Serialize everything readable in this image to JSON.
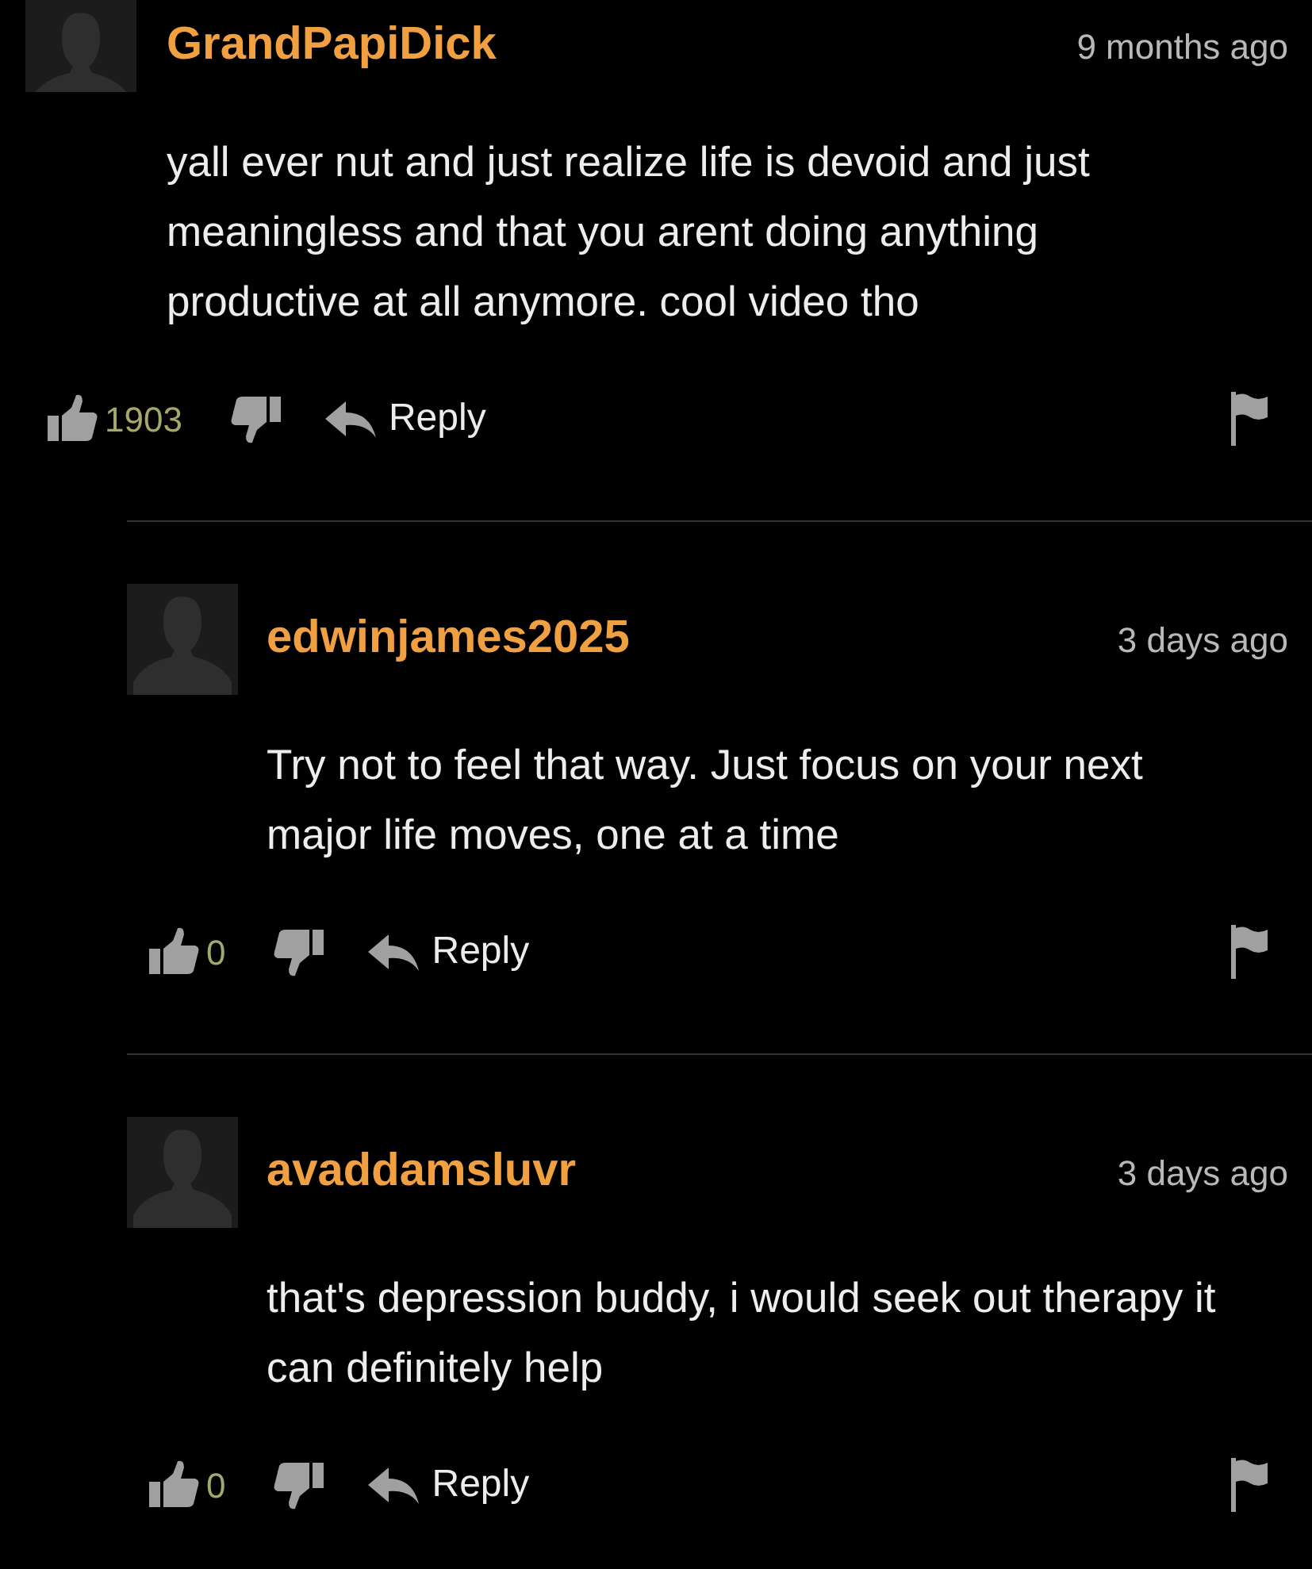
{
  "comments": [
    {
      "username": "GrandPapiDick",
      "time": "9 months ago",
      "text": "yall ever nut and just realize life is devoid and just meaningless and that you arent doing anything productive at all anymore. cool video tho",
      "votes": "1903",
      "reply": "Reply",
      "children": [
        {
          "username": "edwinjames2025",
          "time": "3 days ago",
          "text": "Try not to feel that way. Just focus on your next major life moves, one at a time",
          "votes": "0",
          "reply": "Reply"
        },
        {
          "username": "avaddamsluvr",
          "time": "3 days ago",
          "text": "that's depression buddy, i would seek out therapy it can definitely help",
          "votes": "0",
          "reply": "Reply"
        }
      ]
    }
  ]
}
